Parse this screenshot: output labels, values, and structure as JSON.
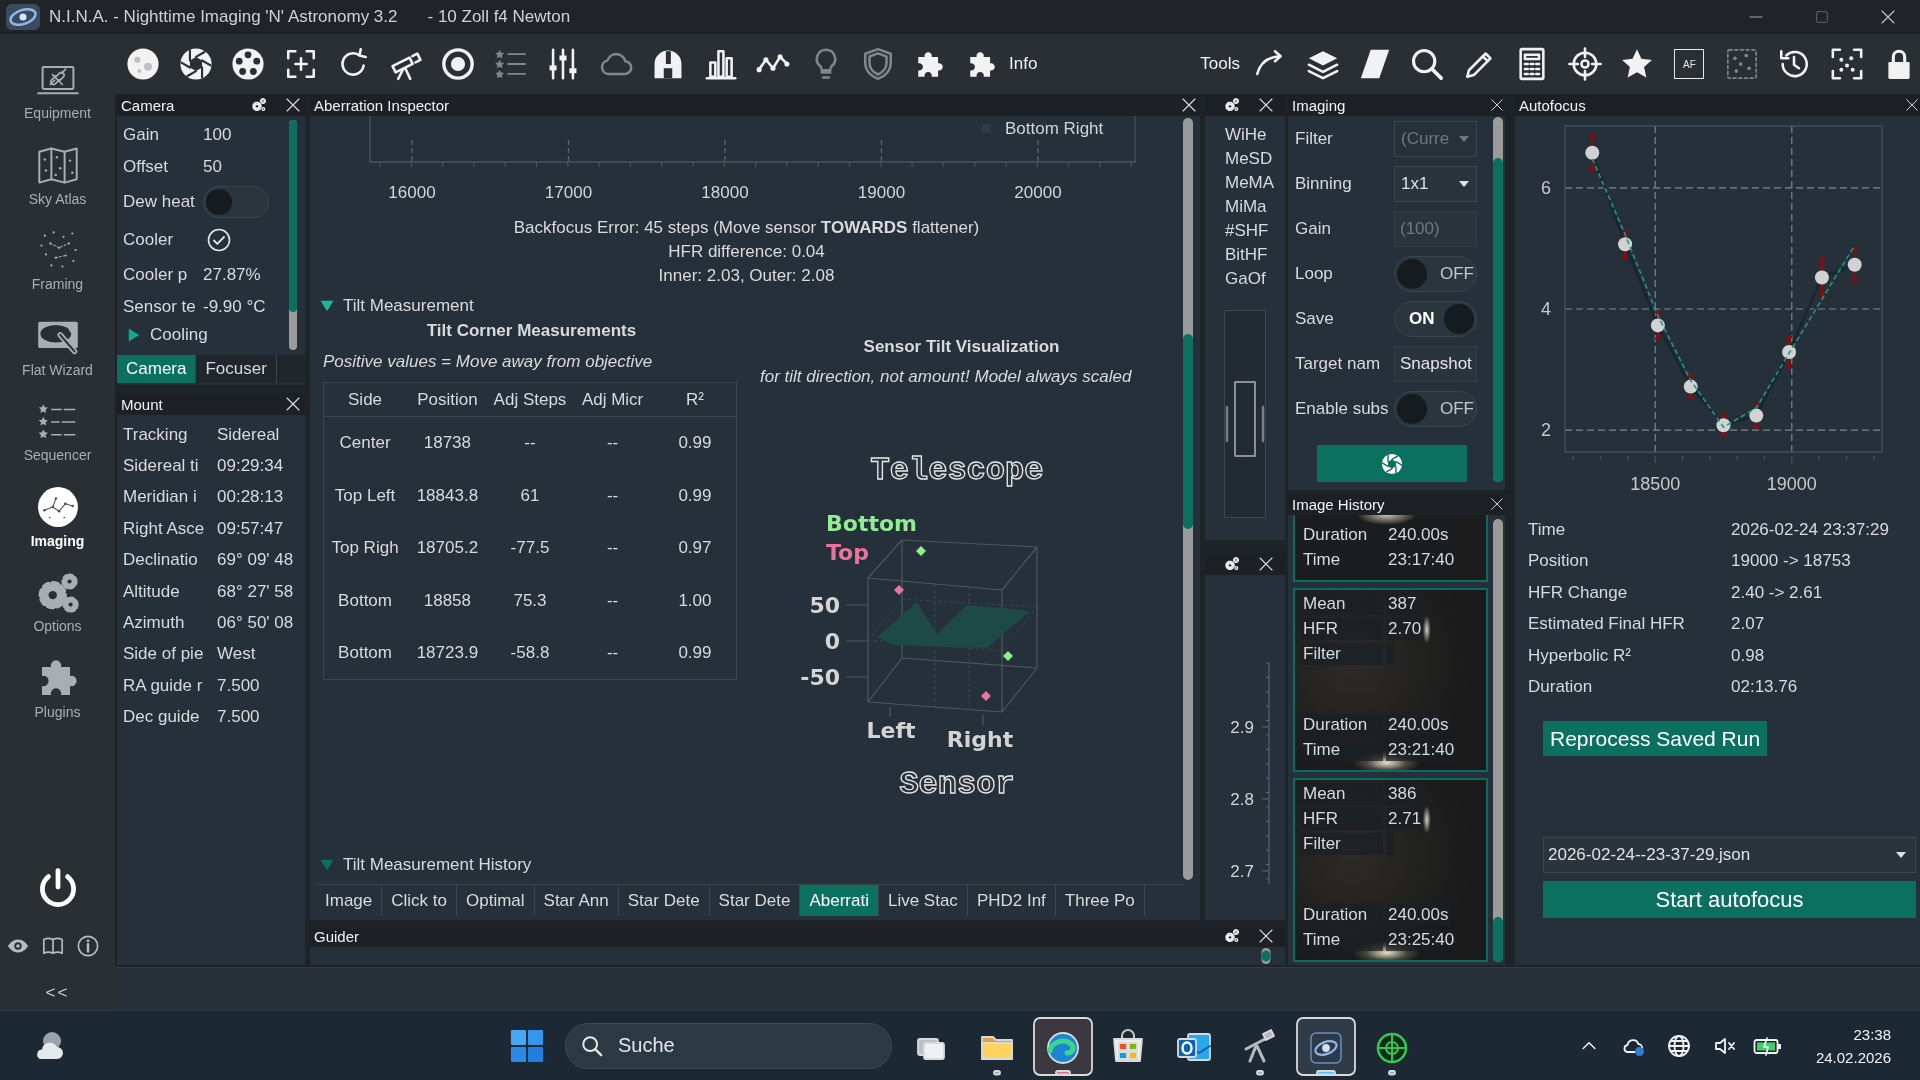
{
  "window": {
    "title": "N.I.N.A. - Nighttime Imaging 'N' Astronomy 3.2",
    "profile": "- 10 Zoll f4 Newton"
  },
  "nav": {
    "items": [
      {
        "label": "Equipment",
        "selected": false
      },
      {
        "label": "Sky Atlas",
        "selected": false
      },
      {
        "label": "Framing",
        "selected": false
      },
      {
        "label": "Flat Wizard",
        "selected": false
      },
      {
        "label": "Sequencer",
        "selected": false
      },
      {
        "label": "Imaging",
        "selected": true
      },
      {
        "label": "Options",
        "selected": false
      },
      {
        "label": "Plugins",
        "selected": false
      }
    ],
    "collapse_label": "<<"
  },
  "toolbar": {
    "left_items": [
      {
        "disabled": false
      },
      {
        "disabled": false
      },
      {
        "disabled": false
      },
      {
        "disabled": false
      },
      {
        "disabled": false
      },
      {
        "disabled": false
      },
      {
        "disabled": false
      },
      {
        "disabled": true
      },
      {
        "disabled": false
      },
      {
        "disabled": true
      },
      {
        "disabled": false
      },
      {
        "disabled": false
      },
      {
        "disabled": false
      },
      {
        "disabled": true
      },
      {
        "disabled": true
      },
      {
        "disabled": false
      },
      {
        "disabled": false,
        "label": "Info"
      }
    ],
    "tools_label": "Tools",
    "right_items": [
      {
        "disabled": false
      },
      {
        "disabled": false
      },
      {
        "disabled": false
      },
      {
        "disabled": false
      },
      {
        "disabled": false
      },
      {
        "disabled": false
      },
      {
        "disabled": false
      },
      {
        "disabled": false
      },
      {
        "disabled": false,
        "badge": "AF"
      },
      {
        "disabled": true
      },
      {
        "disabled": false
      },
      {
        "disabled": false
      },
      {
        "disabled": false
      }
    ]
  },
  "camera_panel": {
    "title": "Camera",
    "rows": [
      {
        "kind": "value",
        "label": "Gain",
        "value": "100"
      },
      {
        "kind": "value",
        "label": "Offset",
        "value": "50"
      },
      {
        "kind": "toggle",
        "label": "Dew heat",
        "on": false
      },
      {
        "kind": "check",
        "label": "Cooler",
        "checked": true
      },
      {
        "kind": "value",
        "label": "Cooler p",
        "value": "27.87%"
      },
      {
        "kind": "value",
        "label": "Sensor te",
        "value": "-9.90 °C"
      }
    ],
    "expander": {
      "label": "Cooling",
      "expanded": false
    },
    "tabs": [
      {
        "label": "Camera",
        "selected": true
      },
      {
        "label": "Focuser",
        "selected": false
      }
    ]
  },
  "mount_panel": {
    "title": "Mount",
    "rows": [
      {
        "label": "Tracking",
        "value": "Sidereal"
      },
      {
        "label": "Sidereal ti",
        "value": "09:29:34"
      },
      {
        "label": "Meridian i",
        "value": "00:28:13"
      },
      {
        "label": "Right Asce",
        "value": "09:57:47"
      },
      {
        "label": "Declinatio",
        "value": "69° 09' 48"
      },
      {
        "label": "Altitude",
        "value": "68° 27' 58"
      },
      {
        "label": "Azimuth",
        "value": "06° 50' 08"
      },
      {
        "label": "Side of pie",
        "value": "West"
      },
      {
        "label": "RA guide r",
        "value": "7.500"
      },
      {
        "label": "Dec guide",
        "value": "7.500"
      }
    ]
  },
  "aberration_panel": {
    "title": "Aberration Inspector",
    "focus_plot": {
      "legend": "Bottom Right",
      "tick_labels": [
        "16000",
        "17000",
        "18000",
        "19000",
        "20000"
      ]
    },
    "summary": [
      "Backfocus Error: 45 steps (Move sensor **TOWARDS** flattener)",
      "HFR difference: 0.04",
      "Inner: 2.03, Outer: 2.08"
    ],
    "tilt_section": {
      "label": "Tilt Measurement",
      "expanded": true
    },
    "corner_table": {
      "title": "Tilt Corner Measurements",
      "note": "Positive values = Move away from objective",
      "columns": [
        "Side",
        "Position",
        "Adj Steps",
        "Adj Micr",
        "R²"
      ],
      "rows": [
        [
          "Center",
          "18738",
          "--",
          "--",
          "0.99"
        ],
        [
          "Top Left",
          "18843.8",
          "61",
          "--",
          "0.99"
        ],
        [
          "Top Righ",
          "18705.2",
          "-77.5",
          "--",
          "0.97"
        ],
        [
          "Bottom",
          "18858",
          "75.3",
          "--",
          "1.00"
        ],
        [
          "Bottom",
          "18723.9",
          "-58.8",
          "--",
          "0.99"
        ]
      ]
    },
    "tilt_visualization": {
      "title": "Sensor Tilt Visualization",
      "note": "for tilt direction, not amount! Model always scaled",
      "top_label": "Telescope",
      "bottom_label": "Sensor",
      "legend": [
        {
          "label": "Bottom",
          "color": "#90ee90"
        },
        {
          "label": "Top",
          "color": "#e8739c"
        }
      ],
      "z_ticks": [
        "50",
        "0",
        "-50"
      ],
      "x_labels": [
        "Left",
        "Right"
      ]
    },
    "history_section": {
      "label": "Tilt Measurement History",
      "expanded": true
    }
  },
  "dock_tabs": [
    {
      "label": "Image",
      "selected": false
    },
    {
      "label": "Click to",
      "selected": false
    },
    {
      "label": "Optimal",
      "selected": false
    },
    {
      "label": "Star Ann",
      "selected": false
    },
    {
      "label": "Star Dete",
      "selected": false
    },
    {
      "label": "Star Dete",
      "selected": false
    },
    {
      "label": "Aberrati",
      "selected": true
    },
    {
      "label": "Live Stac",
      "selected": false
    },
    {
      "label": "PHD2 Inf",
      "selected": false
    },
    {
      "label": "Three Po",
      "selected": false
    }
  ],
  "guider_panel": {
    "title": "Guider"
  },
  "stats_panel": {
    "labels": [
      "WiHe",
      "MeSD",
      "MeMA",
      "MiMa",
      "#SHF",
      "BitHF",
      "GaOf"
    ],
    "slider": {
      "level": 0.46
    }
  },
  "hfr_panel": {
    "tick_labels": [
      "2.9",
      "2.8",
      "2.7"
    ]
  },
  "imaging_panel": {
    "title": "Imaging",
    "rows": [
      {
        "kind": "dropdown",
        "label": "Filter",
        "value": "(Curre",
        "disabled": true
      },
      {
        "kind": "dropdown",
        "label": "Binning",
        "value": "1x1",
        "disabled": false
      },
      {
        "kind": "input",
        "label": "Gain",
        "placeholder": "(100)"
      },
      {
        "kind": "toggle",
        "label": "Loop",
        "on": false,
        "state_text": "OFF"
      },
      {
        "kind": "toggle",
        "label": "Save",
        "on": true,
        "state_text": "ON"
      },
      {
        "kind": "input",
        "label": "Target nam",
        "value": "Snapshot"
      },
      {
        "kind": "toggle",
        "label": "Enable subs",
        "on": false,
        "state_text": "OFF"
      }
    ]
  },
  "image_history": {
    "title": "Image History",
    "cards": [
      {
        "bottom_rows": [
          {
            "label": "Duration",
            "value": "240.00s"
          },
          {
            "label": "Time",
            "value": "23:17:40"
          }
        ]
      },
      {
        "top_rows": [
          {
            "label": "Mean",
            "value": "387"
          },
          {
            "label": "HFR",
            "value": "2.70"
          },
          {
            "label": "Filter"
          }
        ],
        "bottom_rows": [
          {
            "label": "Duration",
            "value": "240.00s"
          },
          {
            "label": "Time",
            "value": "23:21:40"
          }
        ]
      },
      {
        "top_rows": [
          {
            "label": "Mean",
            "value": "386"
          },
          {
            "label": "HFR",
            "value": "2.71"
          },
          {
            "label": "Filter"
          }
        ],
        "bottom_rows": [
          {
            "label": "Duration",
            "value": "240.00s"
          },
          {
            "label": "Time",
            "value": "23:25:40"
          }
        ]
      }
    ]
  },
  "autofocus_panel": {
    "title": "Autofocus",
    "chart_data": {
      "type": "line",
      "x": [
        18270,
        18390,
        18510,
        18630,
        18750,
        18870,
        18990,
        19110,
        19230
      ],
      "series": [
        {
          "color": "#d2d2d2",
          "marker": "circle",
          "values": [
            6.58,
            5.07,
            3.73,
            2.72,
            2.08,
            2.24,
            3.29,
            4.52,
            4.73
          ],
          "errors": [
            0.28,
            0.22,
            0.22,
            0.18,
            0.16,
            0.19,
            0.25,
            0.3,
            0.27
          ]
        },
        {
          "color": "#1a9a86",
          "line_style": "dashed",
          "values": [
            6.48,
            5.23,
            3.89,
            2.82,
            2.05,
            2.37,
            3.27,
            4.16,
            5.05
          ]
        }
      ],
      "xticks": [
        18500,
        19000
      ],
      "yticks": [
        2,
        4,
        6
      ],
      "xlim": [
        18170,
        19330
      ],
      "ylim": [
        1.64,
        7.02
      ],
      "grid": true
    },
    "rows": [
      {
        "label": "Time",
        "value": "2026-02-24 23:37:29"
      },
      {
        "label": "Position",
        "value": "19000 -> 18753"
      },
      {
        "label": "HFR Change",
        "value": "2.40 -> 2.61"
      },
      {
        "label": "Estimated Final HFR",
        "value": "2.07"
      },
      {
        "label": "Hyperbolic R²",
        "value": "0.98"
      },
      {
        "label": "Duration",
        "value": "02:13.76"
      }
    ],
    "reprocess_button": "Reprocess Saved Run",
    "file_select": {
      "value": "2026-02-24--23-37-29.json"
    },
    "start_button": "Start autofocus"
  },
  "taskbar": {
    "search": {
      "placeholder": "Suche"
    },
    "apps": [
      {
        "running": false,
        "selected": false,
        "attention": false
      },
      {
        "running": true,
        "selected": false,
        "attention": false
      },
      {
        "running": true,
        "selected": false,
        "attention": true
      },
      {
        "running": false,
        "selected": false,
        "attention": false
      },
      {
        "running": false,
        "selected": false,
        "attention": false
      },
      {
        "running": true,
        "selected": false,
        "attention": false
      },
      {
        "running": true,
        "selected": true,
        "attention": false
      },
      {
        "running": true,
        "selected": false,
        "attention": false
      }
    ],
    "clock": {
      "time": "23:38",
      "date": "24.02.2026"
    }
  }
}
